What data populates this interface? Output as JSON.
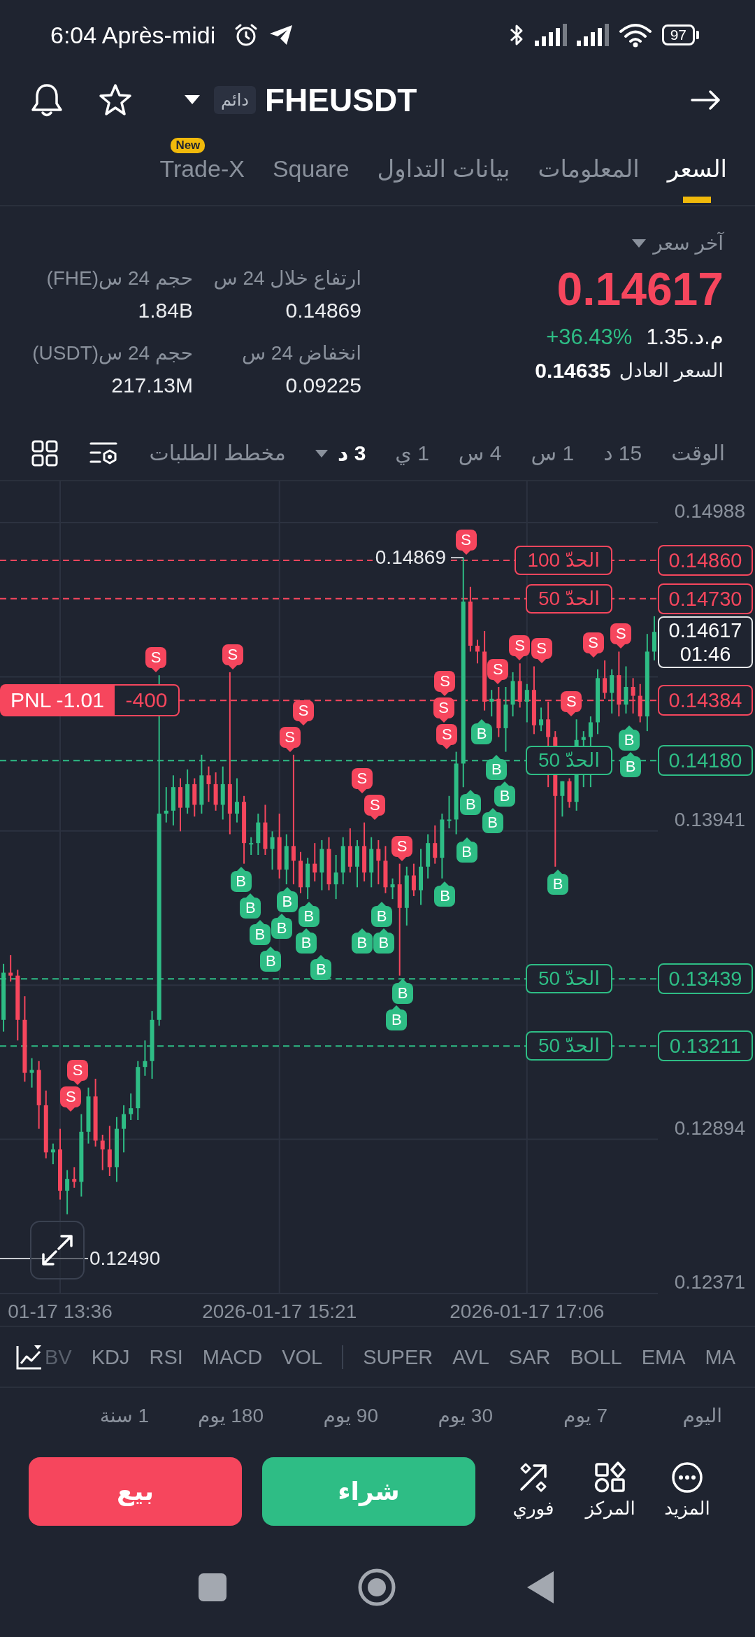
{
  "status_bar": {
    "time": "6:04 Après-midi",
    "battery": "97"
  },
  "header": {
    "badge": "دائم",
    "symbol": "FHEUSDT"
  },
  "tabs": [
    {
      "label": "السعر",
      "selected": true
    },
    {
      "label": "المعلومات",
      "selected": false
    },
    {
      "label": "بيانات التداول",
      "selected": false
    },
    {
      "label": "Square",
      "selected": false
    },
    {
      "label": "Trade-X",
      "selected": false,
      "badge": "New"
    }
  ],
  "ticker": {
    "last_label": "آخر سعر",
    "last_price": "0.14617",
    "mark_price": "م.د.1.35",
    "change": "+36.43%",
    "fair_label": "السعر العادل",
    "fair_price": "0.14635"
  },
  "stats": [
    {
      "label": "ارتفاع خلال 24 س",
      "value": "0.14869"
    },
    {
      "label": "حجم 24 س(FHE)",
      "value": "1.84B"
    },
    {
      "label": "انخفاض 24 س",
      "value": "0.09225"
    },
    {
      "label": "حجم 24 س(USDT)",
      "value": "217.13M"
    }
  ],
  "intervals": [
    {
      "label": "الوقت",
      "selected": false,
      "kind": "option"
    },
    {
      "label": "15 د",
      "selected": false,
      "kind": "option"
    },
    {
      "label": "1 س",
      "selected": false,
      "kind": "option"
    },
    {
      "label": "4 س",
      "selected": false,
      "kind": "option"
    },
    {
      "label": "1 ي",
      "selected": false,
      "kind": "option"
    },
    {
      "label": "3 د",
      "selected": true,
      "kind": "dropdown"
    },
    {
      "label": "مخطط الطلبات",
      "selected": false,
      "kind": "option"
    }
  ],
  "chart": {
    "chart_data": {
      "type": "candlestick",
      "categories": [
        null,
        null,
        null,
        null,
        null,
        null,
        null,
        null,
        "01-17 13:36",
        null,
        null,
        null,
        null,
        null,
        null,
        null,
        null,
        null,
        null,
        null,
        null,
        null,
        null,
        null,
        null,
        null,
        null,
        null,
        null,
        null,
        null,
        null,
        null,
        null,
        null,
        null,
        null,
        null,
        null,
        "2026-01-17 15:21",
        null,
        null,
        null,
        null,
        null,
        null,
        null,
        null,
        null,
        null,
        null,
        null,
        null,
        null,
        null,
        null,
        null,
        null,
        null,
        null,
        null,
        null,
        null,
        null,
        null,
        null,
        null,
        null,
        null,
        null,
        null,
        null,
        null,
        null,
        "2026-01-17 17:06",
        null,
        null,
        null,
        null,
        null,
        null,
        null,
        null,
        null,
        null,
        null,
        null,
        null,
        null,
        null,
        null,
        null,
        null
      ],
      "ohlc": [
        [
          0.133,
          0.1349,
          0.1326,
          0.1346
        ],
        [
          0.1346,
          0.1352,
          0.1343,
          0.1345
        ],
        [
          0.1345,
          0.1347,
          0.1323,
          0.133
        ],
        [
          0.133,
          0.1338,
          0.1309,
          0.1312
        ],
        [
          0.1312,
          0.1317,
          0.1307,
          0.1313
        ],
        [
          0.1313,
          0.1316,
          0.1293,
          0.1301
        ],
        [
          0.1301,
          0.1306,
          0.1283,
          0.1285
        ],
        [
          0.1285,
          0.1288,
          0.1281,
          0.1286
        ],
        [
          0.1286,
          0.1293,
          0.1269,
          0.1272
        ],
        [
          0.1272,
          0.1279,
          0.1264,
          0.1276
        ],
        [
          0.1276,
          0.128,
          0.1273,
          0.1275
        ],
        [
          0.1275,
          0.1298,
          0.127,
          0.1292
        ],
        [
          0.1292,
          0.1307,
          0.1288,
          0.1304
        ],
        [
          0.1304,
          0.131,
          0.1287,
          0.1289
        ],
        [
          0.1289,
          0.1291,
          0.1279,
          0.1286
        ],
        [
          0.1286,
          0.1294,
          0.1277,
          0.128
        ],
        [
          0.128,
          0.1297,
          0.1275,
          0.1293
        ],
        [
          0.1293,
          0.1301,
          0.1285,
          0.1298
        ],
        [
          0.1298,
          0.1305,
          0.1296,
          0.13
        ],
        [
          0.13,
          0.1316,
          0.1296,
          0.1314
        ],
        [
          0.1314,
          0.1323,
          0.1311,
          0.1316
        ],
        [
          0.1316,
          0.1333,
          0.131,
          0.133
        ],
        [
          0.133,
          0.1447,
          0.1328,
          0.14
        ],
        [
          0.14,
          0.1409,
          0.1397,
          0.1401
        ],
        [
          0.1401,
          0.1413,
          0.1396,
          0.1409
        ],
        [
          0.1409,
          0.1412,
          0.1394,
          0.1402
        ],
        [
          0.1402,
          0.1415,
          0.14,
          0.141
        ],
        [
          0.141,
          0.1412,
          0.1399,
          0.1403
        ],
        [
          0.1403,
          0.142,
          0.14,
          0.1413
        ],
        [
          0.1413,
          0.1416,
          0.1404,
          0.141
        ],
        [
          0.141,
          0.1414,
          0.1401,
          0.1403
        ],
        [
          0.1403,
          0.1416,
          0.1398,
          0.141
        ],
        [
          0.141,
          0.1448,
          0.1393,
          0.14
        ],
        [
          0.14,
          0.1412,
          0.1397,
          0.1404
        ],
        [
          0.1404,
          0.1406,
          0.1383,
          0.139
        ],
        [
          0.139,
          0.1392,
          0.1386,
          0.139
        ],
        [
          0.139,
          0.14,
          0.1386,
          0.1397
        ],
        [
          0.1397,
          0.1403,
          0.1386,
          0.1388
        ],
        [
          0.1388,
          0.1394,
          0.1381,
          0.1392
        ],
        [
          0.1392,
          0.14,
          0.1378,
          0.1381
        ],
        [
          0.1381,
          0.1393,
          0.1376,
          0.1389
        ],
        [
          0.1389,
          0.142,
          0.1376,
          0.1384
        ],
        [
          0.1384,
          0.1387,
          0.1373,
          0.1375
        ],
        [
          0.1375,
          0.1385,
          0.1371,
          0.1383
        ],
        [
          0.1383,
          0.139,
          0.1377,
          0.138
        ],
        [
          0.138,
          0.1391,
          0.1374,
          0.1388
        ],
        [
          0.1388,
          0.1392,
          0.1374,
          0.1376
        ],
        [
          0.1376,
          0.1386,
          0.1371,
          0.138
        ],
        [
          0.138,
          0.1392,
          0.1376,
          0.1389
        ],
        [
          0.1389,
          0.1395,
          0.138,
          0.1382
        ],
        [
          0.1382,
          0.1391,
          0.1375,
          0.1389
        ],
        [
          0.1389,
          0.1397,
          0.1377,
          0.138
        ],
        [
          0.138,
          0.1392,
          0.1375,
          0.1388
        ],
        [
          0.1388,
          0.1391,
          0.1376,
          0.1384
        ],
        [
          0.1384,
          0.1389,
          0.1373,
          0.1375
        ],
        [
          0.1375,
          0.1378,
          0.1371,
          0.1376
        ],
        [
          0.1376,
          0.1383,
          0.1345,
          0.1368
        ],
        [
          0.1368,
          0.1382,
          0.1362,
          0.1379
        ],
        [
          0.1379,
          0.1383,
          0.1372,
          0.1374
        ],
        [
          0.1374,
          0.1388,
          0.1369,
          0.1382
        ],
        [
          0.1382,
          0.1393,
          0.1378,
          0.139
        ],
        [
          0.139,
          0.1396,
          0.1383,
          0.1385
        ],
        [
          0.1385,
          0.14,
          0.1378,
          0.1398
        ],
        [
          0.1398,
          0.1406,
          0.1395,
          0.1398
        ],
        [
          0.1398,
          0.1421,
          0.1393,
          0.1417
        ],
        [
          0.1417,
          0.14869,
          0.1409,
          0.1472
        ],
        [
          0.1472,
          0.1477,
          0.1455,
          0.1457
        ],
        [
          0.1457,
          0.1459,
          0.1451,
          0.1455
        ],
        [
          0.1455,
          0.1462,
          0.1435,
          0.1438
        ],
        [
          0.1438,
          0.1442,
          0.1433,
          0.1439
        ],
        [
          0.1439,
          0.1443,
          0.1426,
          0.1429
        ],
        [
          0.1429,
          0.1443,
          0.1421,
          0.1437
        ],
        [
          0.1437,
          0.1448,
          0.1433,
          0.1445
        ],
        [
          0.1445,
          0.1451,
          0.1436,
          0.1438
        ],
        [
          0.1438,
          0.1444,
          0.1431,
          0.1442
        ],
        [
          0.1442,
          0.145,
          0.1427,
          0.143
        ],
        [
          0.143,
          0.1436,
          0.1428,
          0.1432
        ],
        [
          0.1432,
          0.1438,
          0.1409,
          0.1426
        ],
        [
          0.1426,
          0.1428,
          0.1382,
          0.1406
        ],
        [
          0.1406,
          0.1411,
          0.1399,
          0.1411
        ],
        [
          0.1411,
          0.1412,
          0.1402,
          0.1404
        ],
        [
          0.1404,
          0.1432,
          0.1401,
          0.1425
        ],
        [
          0.1425,
          0.1428,
          0.1409,
          0.1426
        ],
        [
          0.1426,
          0.1433,
          0.1409,
          0.1431
        ],
        [
          0.1431,
          0.1449,
          0.1427,
          0.1446
        ],
        [
          0.1446,
          0.1452,
          0.1439,
          0.1441
        ],
        [
          0.1441,
          0.1449,
          0.1434,
          0.1447
        ],
        [
          0.1447,
          0.1455,
          0.1433,
          0.1437
        ],
        [
          0.1437,
          0.145,
          0.1434,
          0.1443
        ],
        [
          0.1443,
          0.1446,
          0.1434,
          0.144
        ],
        [
          0.144,
          0.1444,
          0.1431,
          0.1433
        ],
        [
          0.1433,
          0.1461,
          0.1428,
          0.1455
        ],
        [
          0.1455,
          0.1467,
          0.1452,
          0.14617
        ]
      ],
      "ylim": [
        0.12371,
        0.14988
      ],
      "yticks": [
        0.14988,
        0.13941,
        0.12894,
        0.12371
      ],
      "grid": true,
      "ref_lines": [
        {
          "axis": "y",
          "value": 0.1486,
          "label": "0.14860",
          "color": "#f6465d"
        },
        {
          "axis": "y",
          "value": 0.1473,
          "label": "0.14730",
          "color": "#f6465d"
        },
        {
          "axis": "y",
          "value": 0.14384,
          "label": "0.14384",
          "color": "#f6465d"
        },
        {
          "axis": "y",
          "value": 0.1418,
          "label": "0.14180",
          "color": "#2ebd85"
        },
        {
          "axis": "y",
          "value": 0.13439,
          "label": "0.13439",
          "color": "#2ebd85"
        },
        {
          "axis": "y",
          "value": 0.13211,
          "label": "0.13211",
          "color": "#2ebd85"
        }
      ]
    },
    "high": "0.14869",
    "low": "0.12490",
    "current": {
      "price": "0.14617",
      "countdown": "01:46"
    },
    "orders": [
      {
        "kind": "limit",
        "label": "الحدّ 100",
        "color": "#f6465d"
      },
      {
        "kind": "limit",
        "label": "الحدّ 50",
        "color": "#f6465d"
      },
      {
        "kind": "position",
        "pnl": "PNL -1.01",
        "quantity": "-400",
        "color": "#f6465d"
      },
      {
        "kind": "limit",
        "label": "الحدّ 50",
        "color": "#2ebd85"
      },
      {
        "kind": "limit",
        "label": "الحدّ 50",
        "color": "#2ebd85"
      },
      {
        "kind": "limit",
        "label": "الحدّ 50",
        "color": "#2ebd85"
      }
    ],
    "markers": [
      {
        "label": "S",
        "kind": "sell"
      },
      {
        "label": "S",
        "kind": "sell"
      },
      {
        "label": "S",
        "kind": "sell"
      },
      {
        "label": "S",
        "kind": "sell"
      },
      {
        "label": "S",
        "kind": "sell"
      },
      {
        "label": "S",
        "kind": "sell"
      },
      {
        "label": "S",
        "kind": "sell"
      },
      {
        "label": "S",
        "kind": "sell"
      },
      {
        "label": "B",
        "kind": "buy"
      },
      {
        "label": "S",
        "kind": "sell"
      },
      {
        "label": "S",
        "kind": "sell"
      },
      {
        "label": "B",
        "kind": "buy"
      },
      {
        "label": "B",
        "kind": "buy"
      },
      {
        "label": "B",
        "kind": "buy"
      },
      {
        "label": "S",
        "kind": "sell"
      },
      {
        "label": "S",
        "kind": "sell"
      },
      {
        "label": "B",
        "kind": "buy"
      },
      {
        "label": "B",
        "kind": "buy"
      },
      {
        "label": "S",
        "kind": "sell"
      },
      {
        "label": "B",
        "kind": "buy"
      },
      {
        "label": "S",
        "kind": "sell"
      },
      {
        "label": "S",
        "kind": "sell"
      },
      {
        "label": "S",
        "kind": "sell"
      },
      {
        "label": "S",
        "kind": "sell"
      },
      {
        "label": "B",
        "kind": "buy"
      },
      {
        "label": "B",
        "kind": "buy"
      },
      {
        "label": "B",
        "kind": "buy"
      },
      {
        "label": "B",
        "kind": "buy"
      },
      {
        "label": "B",
        "kind": "buy"
      },
      {
        "label": "B",
        "kind": "buy"
      },
      {
        "label": "B",
        "kind": "buy"
      },
      {
        "label": "B",
        "kind": "buy"
      },
      {
        "label": "B",
        "kind": "buy"
      },
      {
        "label": "B",
        "kind": "buy"
      },
      {
        "label": "B",
        "kind": "buy"
      },
      {
        "label": "B",
        "kind": "buy"
      },
      {
        "label": "B",
        "kind": "buy"
      },
      {
        "label": "B",
        "kind": "buy"
      },
      {
        "label": "B",
        "kind": "buy"
      },
      {
        "label": "B",
        "kind": "buy"
      },
      {
        "label": "B",
        "kind": "buy"
      },
      {
        "label": "S",
        "kind": "sell"
      },
      {
        "label": "S",
        "kind": "sell"
      }
    ]
  },
  "main_indicators": [
    "MA",
    "EMA",
    "BOLL",
    "SAR",
    "AVL",
    "SUPER"
  ],
  "sub_indicators": [
    "VOL",
    "MACD",
    "RSI",
    "KDJ",
    "BV"
  ],
  "periods": [
    "اليوم",
    "7 يوم",
    "30 يوم",
    "90 يوم",
    "180 يوم",
    "1 سنة"
  ],
  "actions": {
    "tools": [
      {
        "label": "المزيد",
        "kind": "more"
      },
      {
        "label": "المركز",
        "kind": "position"
      },
      {
        "label": "فوري",
        "kind": "instant"
      }
    ],
    "buy": "شراء",
    "sell": "بيع"
  }
}
